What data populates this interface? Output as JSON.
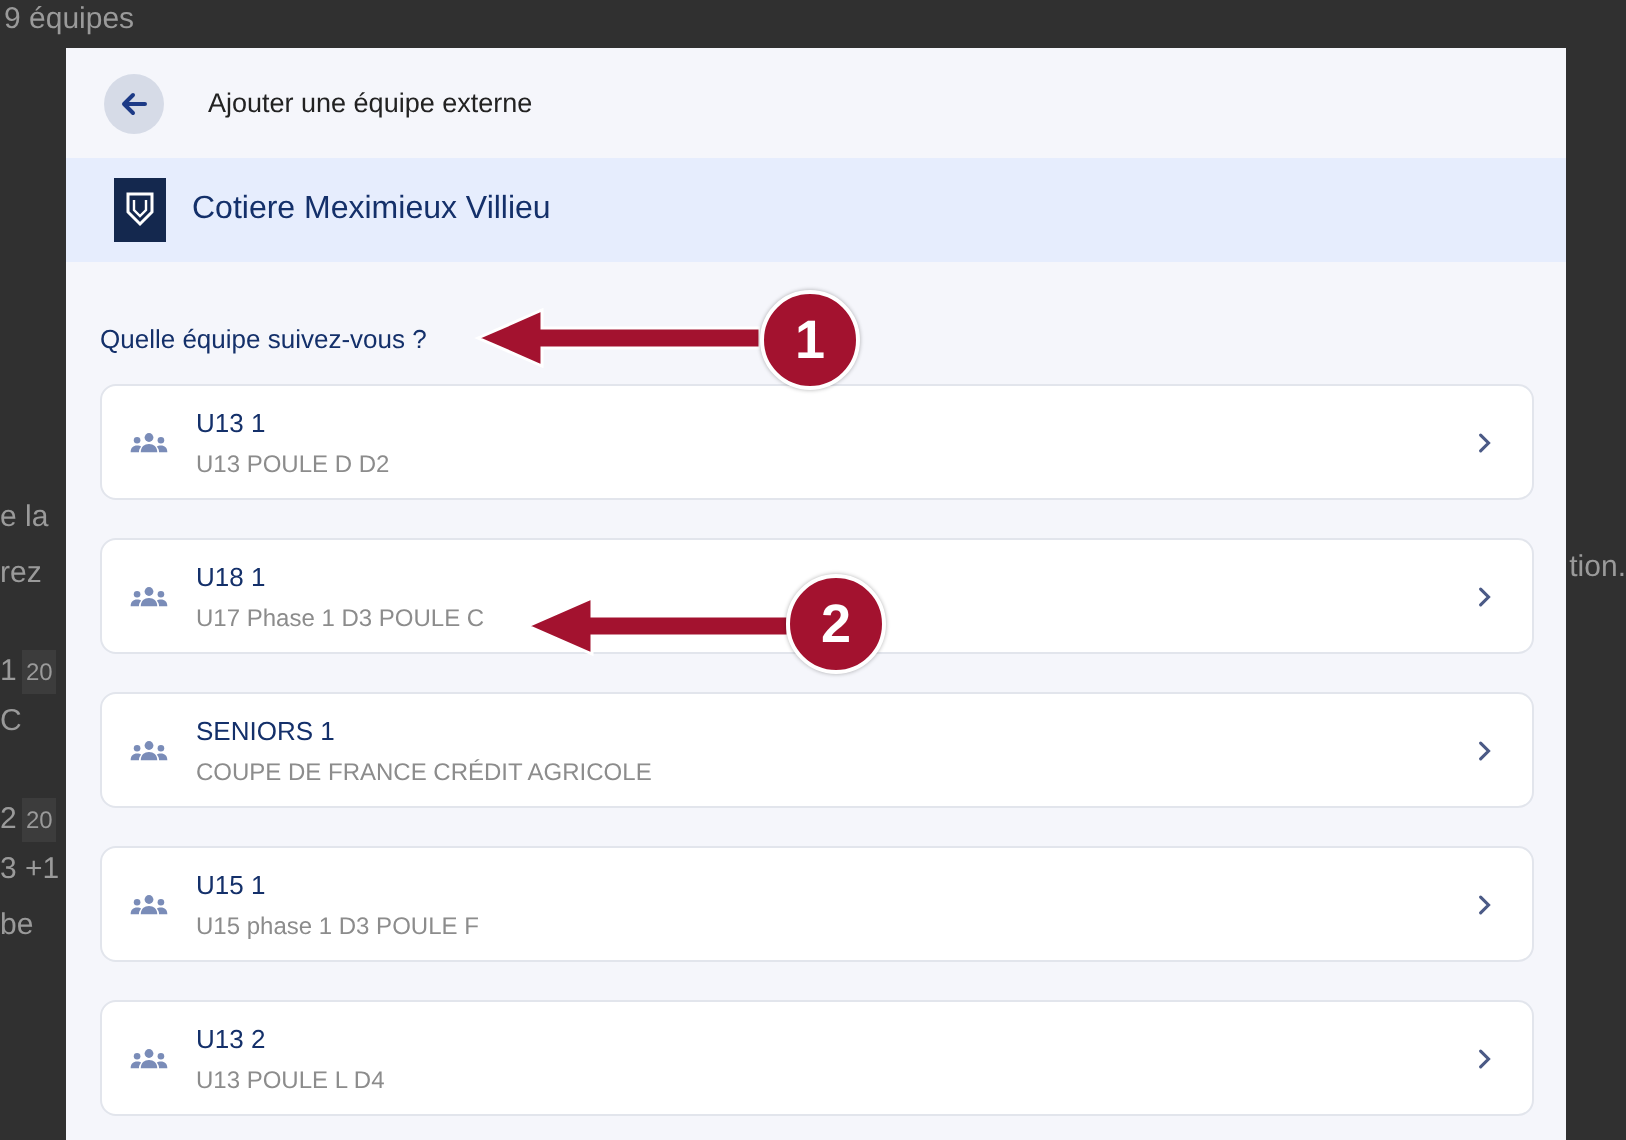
{
  "background": {
    "count": "9 équipes",
    "left_fragments": [
      {
        "text": "e la",
        "kind": "text"
      },
      {
        "text": "rez",
        "kind": "text"
      },
      {
        "text": "1",
        "kind": "title"
      },
      {
        "text": "20",
        "kind": "chip"
      },
      {
        "text": "C",
        "kind": "text"
      },
      {
        "text": "2",
        "kind": "title"
      },
      {
        "text": "20",
        "kind": "chip"
      },
      {
        "text": "3 +1",
        "kind": "text"
      },
      {
        "text": "be",
        "kind": "text"
      }
    ],
    "right_fragment": "tion."
  },
  "modal": {
    "title": "Ajouter une équipe externe",
    "club": "Cotiere Meximieux Villieu",
    "question": "Quelle équipe suivez-vous ?",
    "teams": [
      {
        "name": "U13 1",
        "competition": "U13 POULE D D2"
      },
      {
        "name": "U18 1",
        "competition": "U17 Phase 1 D3 POULE C"
      },
      {
        "name": "SENIORS 1",
        "competition": "COUPE DE FRANCE CRÉDIT AGRICOLE"
      },
      {
        "name": "U15 1",
        "competition": "U15 phase 1 D3 POULE F"
      },
      {
        "name": "U13 2",
        "competition": "U13 POULE L D4"
      }
    ]
  },
  "annotations": [
    {
      "label": "1"
    },
    {
      "label": "2"
    }
  ]
}
